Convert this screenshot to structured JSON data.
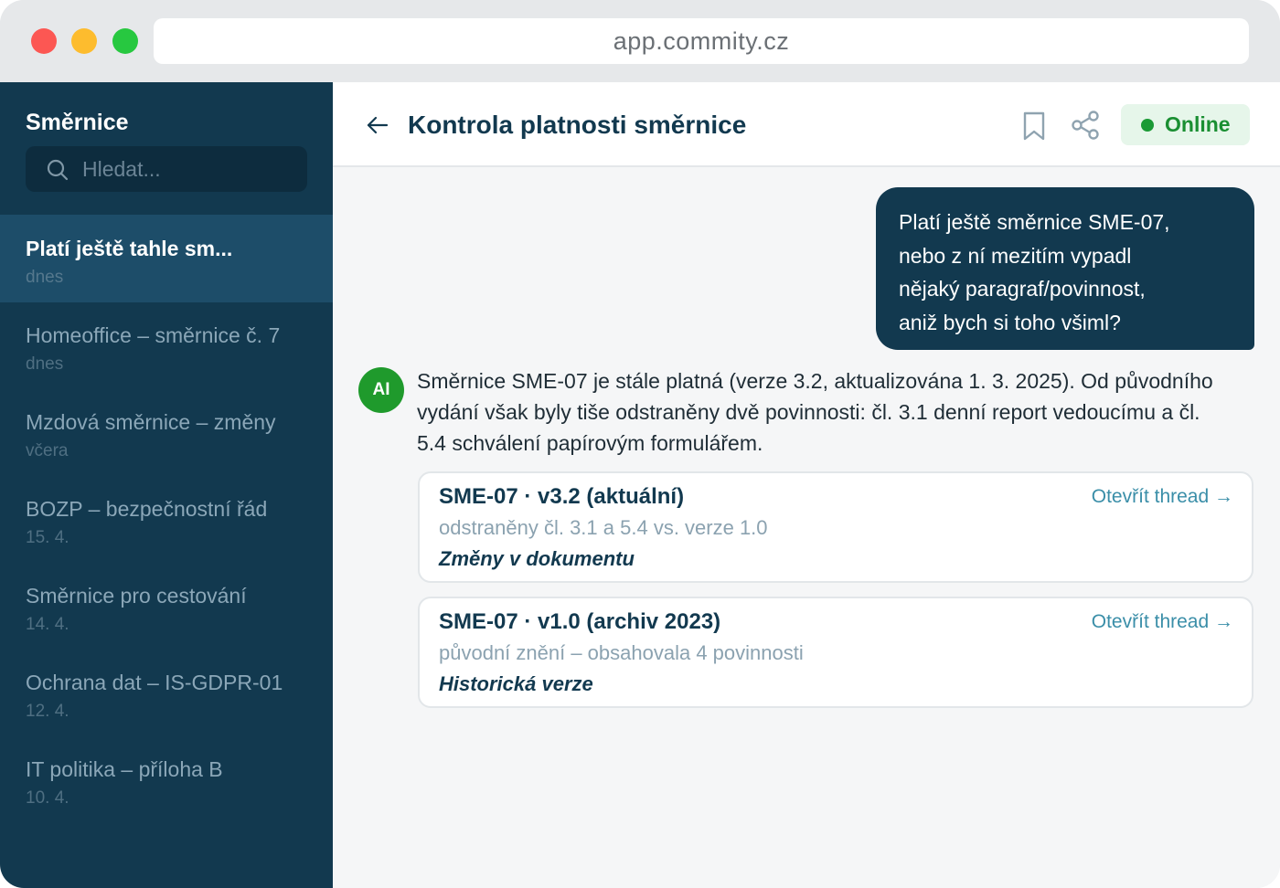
{
  "browser": {
    "url": "app.commity.cz"
  },
  "sidebar": {
    "title": "Směrnice",
    "search_placeholder": "Hledat...",
    "items": [
      {
        "title": "Platí ještě tahle sm...",
        "date": "dnes",
        "active": true
      },
      {
        "title": "Homeoffice – směrnice č. 7",
        "date": "dnes"
      },
      {
        "title": "Mzdová směrnice – změny",
        "date": "včera"
      },
      {
        "title": "BOZP – bezpečnostní řád",
        "date": "15. 4."
      },
      {
        "title": "Směrnice pro cestování",
        "date": "14. 4."
      },
      {
        "title": "Ochrana dat – IS-GDPR-01",
        "date": "12. 4."
      },
      {
        "title": "IT politika – příloha B",
        "date": "10. 4."
      }
    ]
  },
  "header": {
    "title": "Kontrola platnosti směrnice",
    "status": "Online"
  },
  "chat": {
    "user_message_lines": [
      "Platí ještě směrnice SME-07,",
      "nebo z ní mezitím vypadl",
      "nějaký paragraf/povinnost,",
      "aniž bych si toho všiml?"
    ],
    "ai_avatar": "AI",
    "ai_message_lines": [
      "Směrnice SME-07 je stále platná (verze 3.2, aktualizována 1. 3. 2025). Od původního",
      "vydání však byly tiše odstraněny dvě povinnosti: čl. 3.1 denní report vedoucímu a čl.",
      "5.4 schválení papírovým formulářem."
    ],
    "cards": [
      {
        "title": "SME-07 · v3.2 (aktuální)",
        "subtitle": "odstraněny čl. 3.1 a 5.4 vs. verze 1.0",
        "tag": "Změny v dokumentu",
        "link": "Otevřít thread →"
      },
      {
        "title": "SME-07 · v1.0 (archiv 2023)",
        "subtitle": "původní znění – obsahovala 4 povinnosti",
        "tag": "Historická verze",
        "link": "Otevřít thread →"
      }
    ]
  }
}
